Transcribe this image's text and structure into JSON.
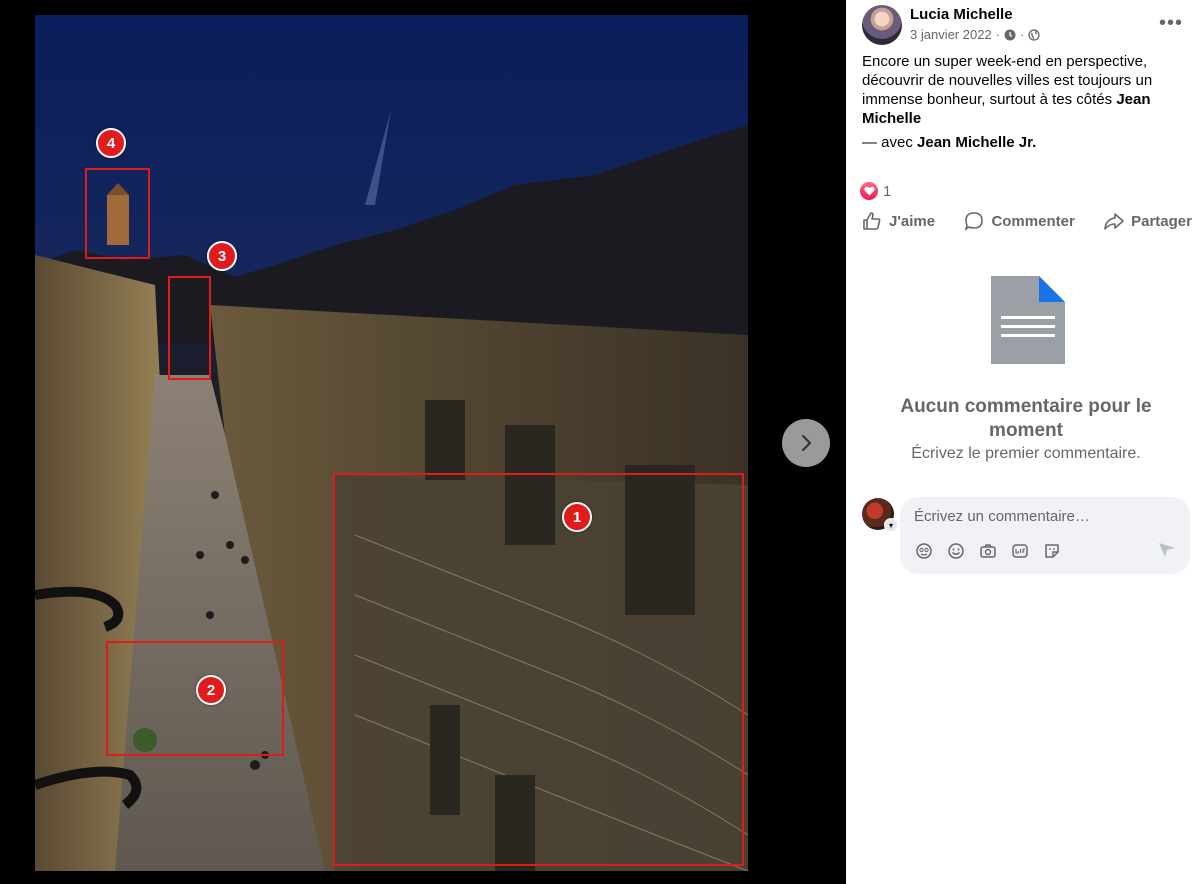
{
  "post": {
    "author": "Lucia Michelle",
    "date": "3 janvier 2022",
    "meta_separator": "·",
    "text_intro": "Encore un super week-end en perspective, découvrir de nouvelles villes est toujours un immense bonheur, surtout à tes côtés ",
    "text_tag": "Jean Michelle",
    "with_prefix": "— avec ",
    "with_tag": "Jean Michelle Jr.",
    "more_label": "•••"
  },
  "reactions": {
    "count": "1"
  },
  "actions": {
    "like": "J'aime",
    "comment": "Commenter",
    "share": "Partager"
  },
  "comments": {
    "empty_title": "Aucun commentaire pour le moment",
    "empty_subtitle": "Écrivez le premier commentaire.",
    "input_placeholder": "Écrivez un commentaire…"
  },
  "markers": [
    {
      "label": "1"
    },
    {
      "label": "2"
    },
    {
      "label": "3"
    },
    {
      "label": "4"
    }
  ],
  "colors": {
    "marker": "#e01b1b",
    "reaction_heart": "#e61e4d",
    "secondary_text": "#65676b",
    "doc_icon": "#9aa0a6",
    "doc_corner": "#1a73e8"
  }
}
